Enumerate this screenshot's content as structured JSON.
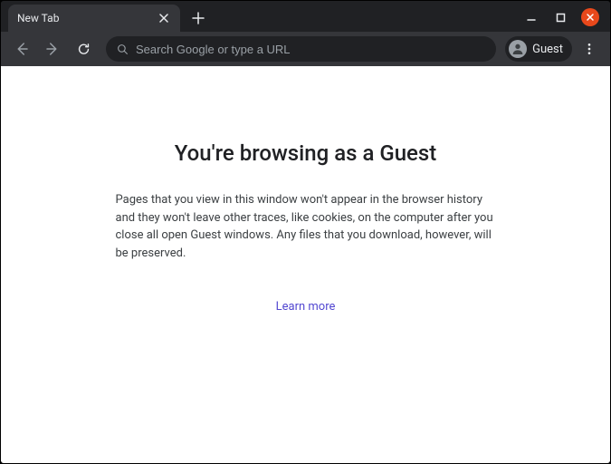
{
  "tab": {
    "title": "New Tab"
  },
  "omnibox": {
    "placeholder": "Search Google or type a URL"
  },
  "profile": {
    "label": "Guest"
  },
  "page": {
    "headline": "You're browsing as a Guest",
    "body": "Pages that you view in this window won't appear in the browser history and they won't leave other traces, like cookies, on the computer after you close all open Guest windows. Any files that you download, however, will be preserved.",
    "learn_more": "Learn more"
  }
}
